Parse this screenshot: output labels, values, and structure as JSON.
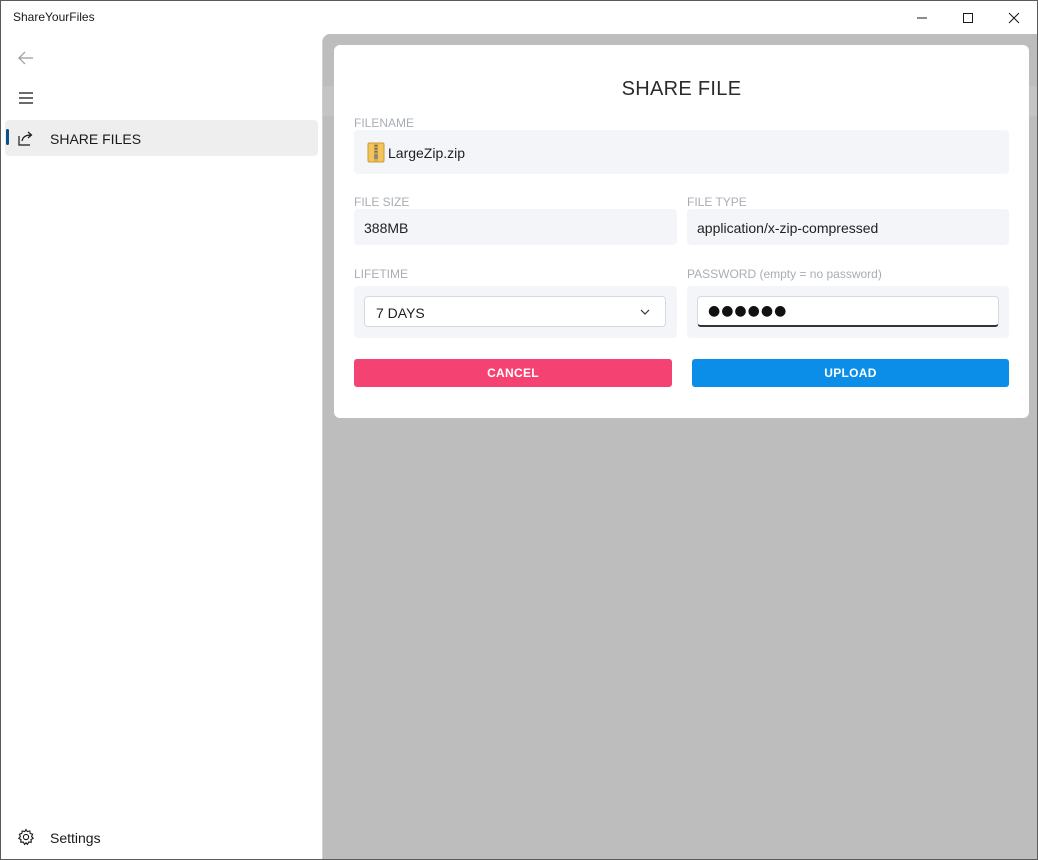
{
  "window": {
    "title": "ShareYourFiles"
  },
  "sidebar": {
    "items": [
      {
        "label": "SHARE FILES",
        "icon": "share-icon",
        "selected": true
      }
    ],
    "settings_label": "Settings"
  },
  "dialog": {
    "title": "SHARE FILE",
    "filename": {
      "label": "FILENAME",
      "value": "LargeZip.zip",
      "icon": "zip-file-icon"
    },
    "file_size": {
      "label": "FILE SIZE",
      "value": "388MB"
    },
    "file_type": {
      "label": "FILE TYPE",
      "value": "application/x-zip-compressed"
    },
    "lifetime": {
      "label": "LIFETIME",
      "selected": "7 DAYS"
    },
    "password": {
      "label": "PASSWORD (empty = no password)",
      "masked_value": "●●●●●●"
    },
    "cancel_label": "CANCEL",
    "upload_label": "UPLOAD"
  },
  "colors": {
    "accent": "#0a8ee8",
    "cancel": "#f44272",
    "overlay": "#bdbdbd",
    "nav_indicator": "#0a4e8a"
  }
}
